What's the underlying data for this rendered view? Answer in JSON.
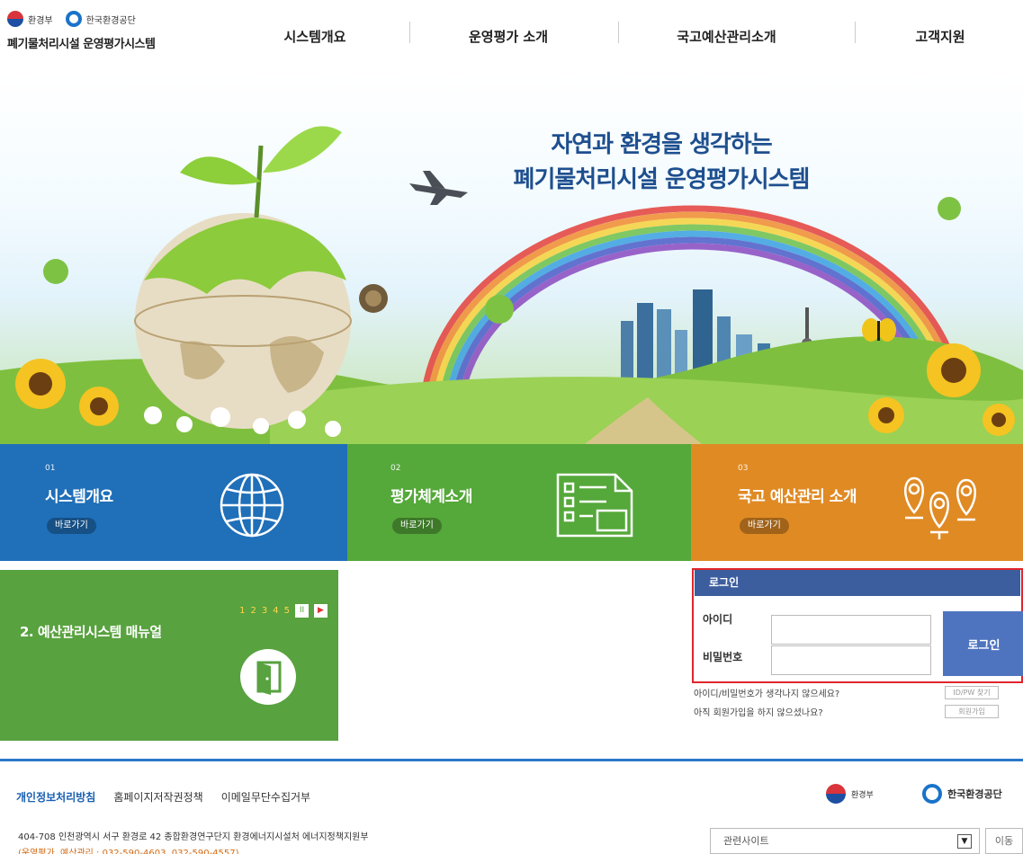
{
  "header": {
    "ministry_logo": "환경부",
    "corp_logo": "한국환경공단",
    "system_title": "폐기물처리시설 운영평가시스템",
    "nav": [
      "시스템개요",
      "운영평가 소개",
      "국고예산관리소개",
      "고객지원"
    ]
  },
  "hero": {
    "headline_line1": "자연과 환경을 생각하는",
    "headline_line2": "폐기물처리시설 운영평가시스템"
  },
  "tiles": [
    {
      "num": "01",
      "title": "시스템개요",
      "button": "바로가기",
      "icon": "globe-icon",
      "color": "#1f6fb9"
    },
    {
      "num": "02",
      "title": "평가체계소개",
      "button": "바로가기",
      "icon": "checklist-document-icon",
      "color": "#55a83a"
    },
    {
      "num": "03",
      "title": "국고 예산관리 소개",
      "button": "바로가기",
      "icon": "location-pin-icon",
      "color": "#e08a24"
    }
  ],
  "manual": {
    "pages": [
      "1",
      "2",
      "3",
      "4",
      "5"
    ],
    "pause_label": "II",
    "next_label": "▶",
    "title": "2. 예산관리시스템 매뉴얼",
    "icon": "door-exit-icon"
  },
  "login": {
    "heading": "로그인",
    "id_label": "아이디",
    "pw_label": "비밀번호",
    "id_value": "",
    "pw_value": "",
    "button": "로그인",
    "forgot_text": "아이디/비밀번호가 생각나지 않으세요?",
    "forgot_button": "ID/PW 찾기",
    "signup_text": "아직 회원가입을 하지 않으셨나요?",
    "signup_button": "회원가입"
  },
  "footer": {
    "links": [
      "개인정보처리방침",
      "홈페이지저작권정책",
      "이메일무단수집거부"
    ],
    "ministry_logo": "환경부",
    "corp_logo": "한국환경공단",
    "address": "404-708 인천광역시 서구 환경로 42 종합환경연구단지 환경에너지시설처 에너지정책지원부",
    "contact": "(운영평가, 예산관리 : 032-590-4603, 032-590-4557)",
    "related_site": "관련사이트",
    "move_button": "이동"
  }
}
